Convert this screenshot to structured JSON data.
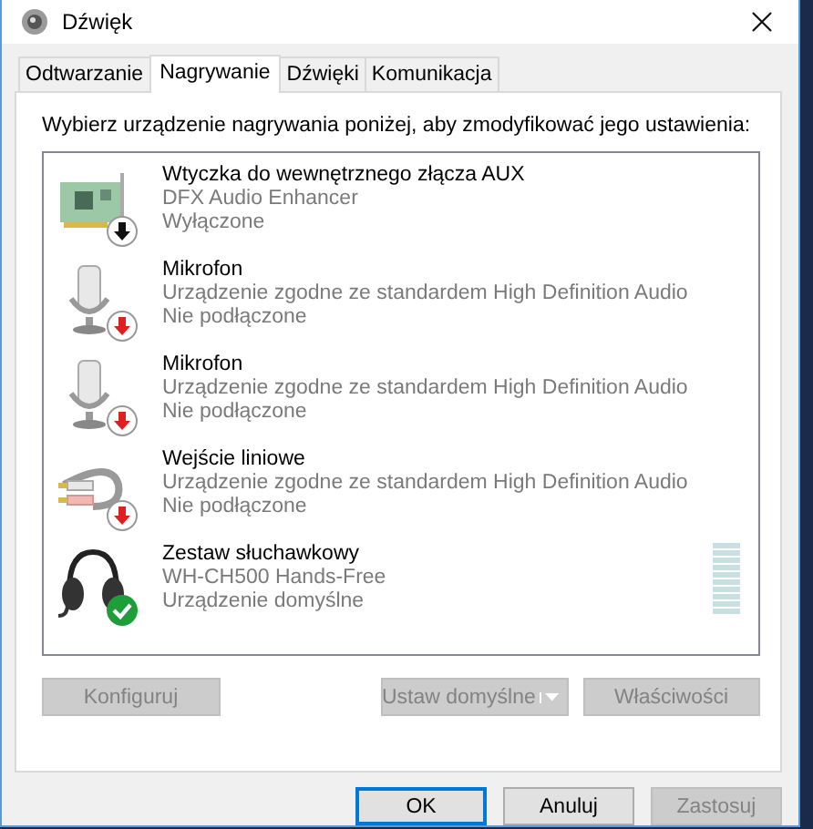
{
  "window": {
    "title": "Dźwięk"
  },
  "tabs": [
    {
      "label": "Odtwarzanie",
      "selected": false
    },
    {
      "label": "Nagrywanie",
      "selected": true
    },
    {
      "label": "Dźwięki",
      "selected": false
    },
    {
      "label": "Komunikacja",
      "selected": false
    }
  ],
  "instruction": "Wybierz urządzenie nagrywania poniżej, aby zmodyfikować jego ustawienia:",
  "devices": [
    {
      "kind": "card",
      "badge": {
        "kind": "disabled"
      },
      "name": "Wtyczka do wewnętrznego złącza AUX",
      "description": "DFX Audio Enhancer",
      "state": "Wyłączone"
    },
    {
      "kind": "mic",
      "badge": {
        "kind": "unplugged"
      },
      "name": "Mikrofon",
      "description": "Urządzenie zgodne ze standardem High Definition Audio",
      "state": "Nie podłączone"
    },
    {
      "kind": "mic",
      "badge": {
        "kind": "unplugged"
      },
      "name": "Mikrofon",
      "description": "Urządzenie zgodne ze standardem High Definition Audio",
      "state": "Nie podłączone"
    },
    {
      "kind": "line",
      "badge": {
        "kind": "unplugged"
      },
      "name": "Wejście liniowe",
      "description": "Urządzenie zgodne ze standardem High Definition Audio",
      "state": "Nie podłączone"
    },
    {
      "kind": "headset",
      "badge": {
        "kind": "default"
      },
      "name": "Zestaw słuchawkowy",
      "description": "WH-CH500 Hands-Free",
      "state": "Urządzenie domyślne"
    }
  ],
  "device_buttons": [
    {
      "label": "Konfiguruj",
      "disabled": true,
      "split": false
    },
    {
      "label": "Ustaw domyślne",
      "disabled": true,
      "split": true
    },
    {
      "label": "Właściwości",
      "disabled": true,
      "split": false
    }
  ],
  "dialog_buttons": [
    {
      "label": "OK",
      "disabled": false,
      "default": true
    },
    {
      "label": "Anuluj",
      "disabled": false,
      "default": false
    },
    {
      "label": "Zastosuj",
      "disabled": true,
      "default": false
    }
  ]
}
